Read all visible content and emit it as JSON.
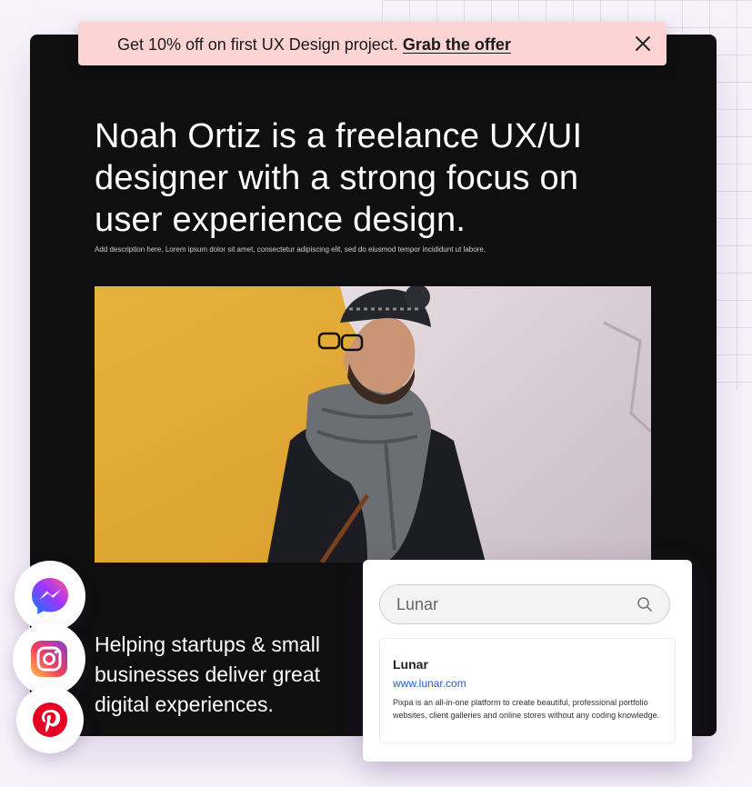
{
  "banner": {
    "text": "Get 10% off on first UX Design project.",
    "link_label": "Grab the offer"
  },
  "hero": {
    "headline": "Noah Ortiz is a freelance UX/UI designer with a strong focus on user experience design.",
    "description": "Add description here. Lorem ipsum dolor sit amet, consectetur adipiscing elit, sed do eiusmod tempor incididunt ut labore.",
    "tagline": "Helping startups & small businesses deliver great digital experiences."
  },
  "search": {
    "value": "Lunar",
    "result": {
      "title": "Lunar",
      "url": "www.lunar.com",
      "description": "Pixpa is an all-in-one platform to create beautiful, professional portfolio websites, client galleries and online stores without any coding knowledge."
    }
  },
  "social_icons": [
    "messenger-icon",
    "instagram-icon",
    "pinterest-icon"
  ],
  "colors": {
    "banner_bg": "#fcd4d4",
    "card_bg": "#0f0f10",
    "link": "#1a5fd6",
    "page_bg": "#f7f3fb"
  }
}
